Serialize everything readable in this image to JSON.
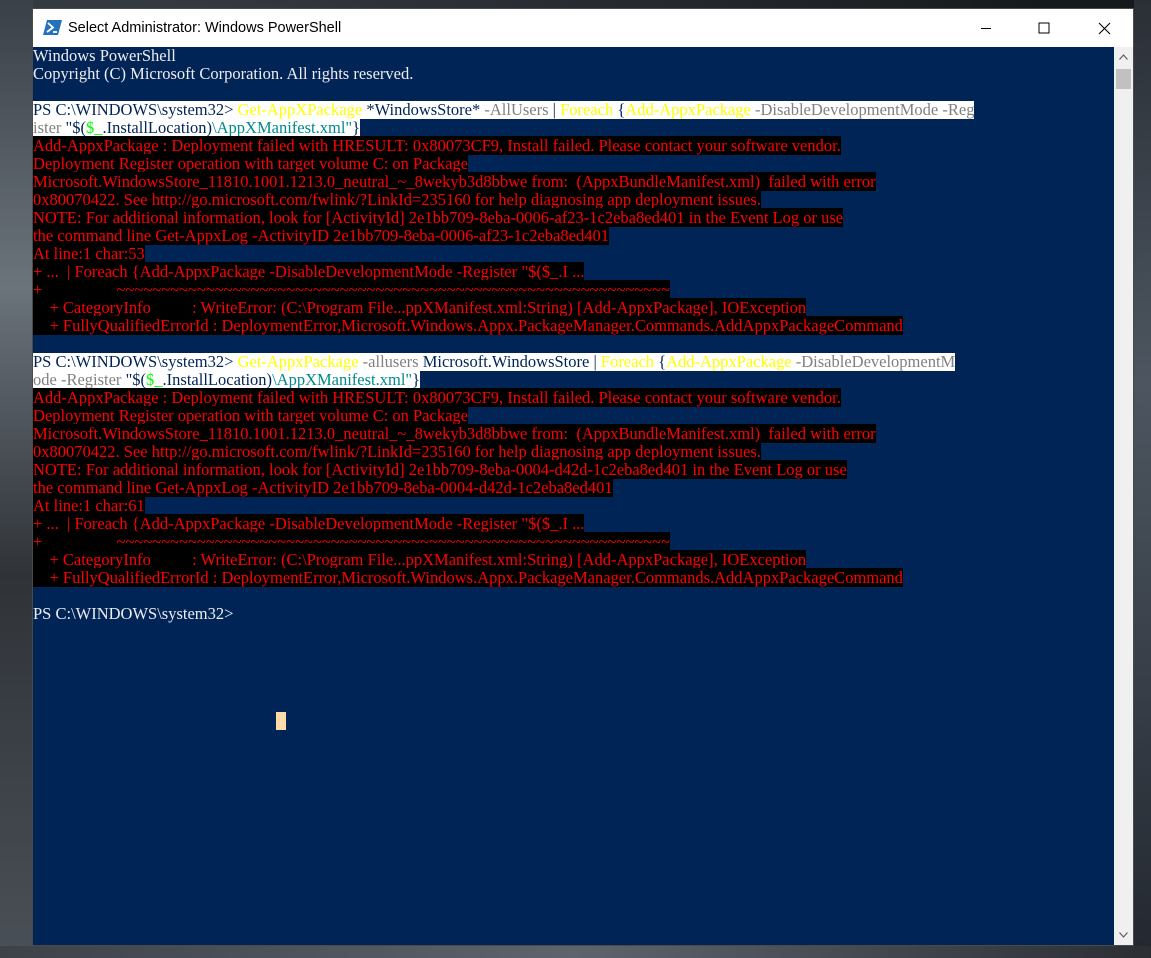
{
  "window": {
    "title": "Select Administrator: Windows PowerShell",
    "buttons": {
      "minimize": "minimize-icon",
      "maximize": "maximize-icon",
      "close": "close-icon"
    }
  },
  "console": {
    "header": [
      "Windows PowerShell",
      "Copyright (C) Microsoft Corporation. All rights reserved."
    ],
    "cmd1": {
      "prompt": "PS C:\\WINDOWS\\system32> ",
      "line1": [
        "Get-AppXPackage",
        " *WindowsStore* ",
        "-AllUsers",
        " | ",
        "Foreach",
        " {",
        "Add-AppxPackage",
        " -DisableDevelopmentMode -Reg"
      ],
      "line2": [
        "ister ",
        "\"$(",
        "$_",
        ".InstallLocation)",
        "\\AppXManifest.xml\"",
        "}"
      ]
    },
    "error1": [
      "Add-AppxPackage : Deployment failed with HRESULT: 0x80073CF9, Install failed. Please contact your software vendor.",
      "Deployment Register operation with target volume C: on Package",
      "Microsoft.WindowsStore_11810.1001.1213.0_neutral_~_8wekyb3d8bbwe from:  (AppxBundleManifest.xml)  failed with error",
      "0x80070422. See http://go.microsoft.com/fwlink/?LinkId=235160 for help diagnosing app deployment issues.",
      "NOTE: For additional information, look for [ActivityId] 2e1bb709-8eba-0006-af23-1c2eba8ed401 in the Event Log or use",
      "the command line Get-AppxLog -ActivityID 2e1bb709-8eba-0006-af23-1c2eba8ed401",
      "At line:1 char:53",
      "+ ...  | Foreach {Add-AppxPackage -DisableDevelopmentMode -Register \"$($_.I ...",
      "+                  ~~~~~~~~~~~~~~~~~~~~~~~~~~~~~~~~~~~~~~~~~~~~~~~~~~~~~~~~~~~~~~",
      "    + CategoryInfo          : WriteError: (C:\\Program File...ppXManifest.xml:String) [Add-AppxPackage], IOException",
      "    + FullyQualifiedErrorId : DeploymentError,Microsoft.Windows.Appx.PackageManager.Commands.AddAppxPackageCommand"
    ],
    "cmd2": {
      "prompt": "PS C:\\WINDOWS\\system32> ",
      "line1": [
        "Get-AppxPackage",
        " -allusers ",
        "Microsoft.WindowsStore",
        " | ",
        "Foreach",
        " {",
        "Add-AppxPackage",
        " -DisableDevelopmentM"
      ],
      "line2": [
        "ode -Register ",
        "\"$(",
        "$_",
        ".InstallLocation)",
        "\\AppXManifest.xml\"",
        "}"
      ]
    },
    "error2": [
      "Add-AppxPackage : Deployment failed with HRESULT: 0x80073CF9, Install failed. Please contact your software vendor.",
      "Deployment Register operation with target volume C: on Package",
      "Microsoft.WindowsStore_11810.1001.1213.0_neutral_~_8wekyb3d8bbwe from:  (AppxBundleManifest.xml)  failed with error",
      "0x80070422. See http://go.microsoft.com/fwlink/?LinkId=235160 for help diagnosing app deployment issues.",
      "NOTE: For additional information, look for [ActivityId] 2e1bb709-8eba-0004-d42d-1c2eba8ed401 in the Event Log or use",
      "the command line Get-AppxLog -ActivityID 2e1bb709-8eba-0004-d42d-1c2eba8ed401",
      "At line:1 char:61",
      "+ ...  | Foreach {Add-AppxPackage -DisableDevelopmentMode -Register \"$($_.I ...",
      "+                  ~~~~~~~~~~~~~~~~~~~~~~~~~~~~~~~~~~~~~~~~~~~~~~~~~~~~~~~~~~~~~~",
      "    + CategoryInfo          : WriteError: (C:\\Program File...ppXManifest.xml:String) [Add-AppxPackage], IOException",
      "    + FullyQualifiedErrorId : DeploymentError,Microsoft.Windows.Appx.PackageManager.Commands.AddAppxPackageCommand"
    ],
    "final_prompt": "PS C:\\WINDOWS\\system32>"
  },
  "colors": {
    "console_bg": "#012456",
    "error_fg": "#ff0000",
    "error_bg": "#000000",
    "command": "#ffff00",
    "parameter": "#808080",
    "variable": "#00ff00",
    "string": "#008b8b",
    "cursor": "#fedba9"
  }
}
